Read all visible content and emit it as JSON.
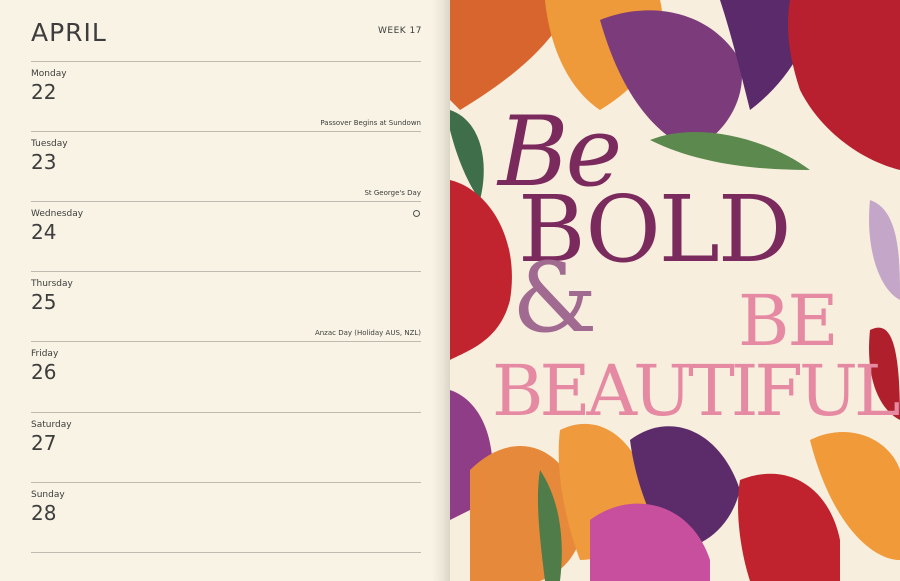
{
  "planner": {
    "month": "APRIL",
    "week": "WEEK 17",
    "days": [
      {
        "name": "Monday",
        "number": "22",
        "event": "Passover Begins at Sundown"
      },
      {
        "name": "Tuesday",
        "number": "23",
        "event": "St George's Day"
      },
      {
        "name": "Wednesday",
        "number": "24",
        "event": ""
      },
      {
        "name": "Thursday",
        "number": "25",
        "event": "Anzac Day (Holiday AUS, NZL)"
      },
      {
        "name": "Friday",
        "number": "26",
        "event": ""
      },
      {
        "name": "Saturday",
        "number": "27",
        "event": ""
      },
      {
        "name": "Sunday",
        "number": "28",
        "event": ""
      }
    ]
  },
  "artwork": {
    "line1": "Be",
    "line2": "BOLD",
    "ampersand": "&",
    "line3": "BE",
    "line4": "BEAUTIFUL"
  },
  "colors": {
    "paper": "#f8f3e4",
    "ink": "#3d3d3d",
    "plum": "#7b2a5e",
    "pink": "#e68aa3"
  }
}
